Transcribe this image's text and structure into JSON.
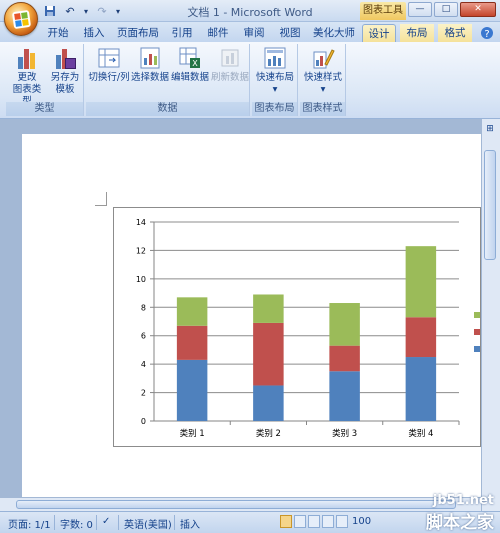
{
  "window": {
    "title": "文档 1 - Microsoft Word",
    "context_group": "图表工具",
    "minimize": "—",
    "maximize": "□",
    "close": "✕"
  },
  "tabs": [
    "开始",
    "插入",
    "页面布局",
    "引用",
    "邮件",
    "审阅",
    "视图",
    "美化大师",
    "设计",
    "布局",
    "格式"
  ],
  "active_tab": "设计",
  "ribbon": {
    "groups": [
      {
        "label": "类型",
        "buttons": [
          {
            "line1": "更改",
            "line2": "图表类型",
            "icon": "chart-type-icon"
          },
          {
            "line1": "另存为",
            "line2": "模板",
            "icon": "save-template-icon"
          }
        ]
      },
      {
        "label": "数据",
        "buttons": [
          {
            "line1": "切换行/列",
            "icon": "switch-row-col-icon"
          },
          {
            "line1": "选择数据",
            "icon": "select-data-icon"
          },
          {
            "line1": "编辑数据",
            "icon": "edit-data-icon"
          },
          {
            "line1": "刷新数据",
            "icon": "refresh-data-icon",
            "disabled": true
          }
        ]
      },
      {
        "label": "图表布局",
        "buttons": [
          {
            "line1": "快速布局",
            "line2": "▾",
            "icon": "quick-layout-icon"
          }
        ]
      },
      {
        "label": "图表样式",
        "buttons": [
          {
            "line1": "快速样式",
            "line2": "▾",
            "icon": "quick-style-icon"
          }
        ]
      }
    ]
  },
  "status": {
    "page": "页面: 1/1",
    "words": "字数: 0",
    "language": "英语(美国)",
    "mode": "插入",
    "zoom": "100"
  },
  "watermark": {
    "line1": "jb51.net",
    "line2": "脚本之家"
  },
  "colors": {
    "series1": "#4f81bd",
    "series2": "#c0504d",
    "series3": "#9bbb59"
  },
  "chart_data": {
    "type": "bar",
    "stacked": true,
    "categories": [
      "类别 1",
      "类别 2",
      "类别 3",
      "类别 4"
    ],
    "series": [
      {
        "values": [
          4.3,
          2.5,
          3.5,
          4.5
        ]
      },
      {
        "values": [
          2.4,
          4.4,
          1.8,
          2.8
        ]
      },
      {
        "values": [
          2.0,
          2.0,
          3.0,
          5.0
        ]
      }
    ],
    "ylim": [
      0,
      14
    ],
    "yticks": [
      "0",
      "2",
      "4",
      "6",
      "8",
      "10",
      "12",
      "14"
    ],
    "grid": true,
    "legend": "right"
  }
}
